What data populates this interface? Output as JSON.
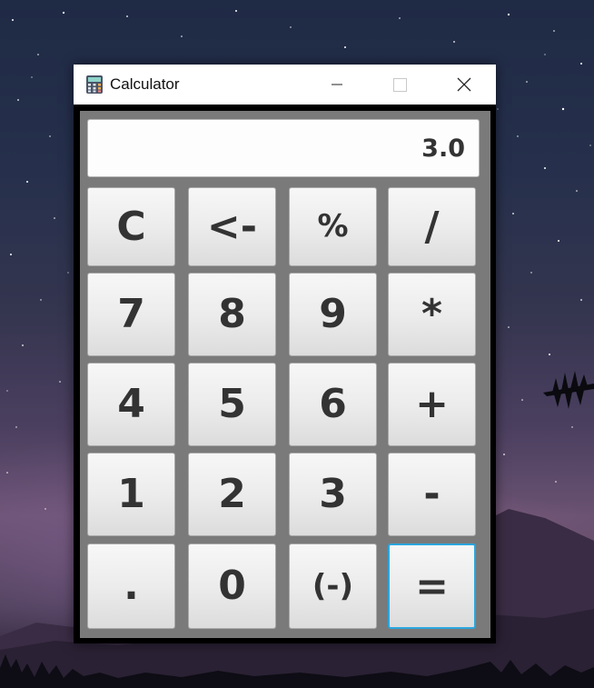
{
  "window": {
    "title": "Calculator",
    "icon": "calculator-app-icon",
    "controls": [
      "minimize-icon",
      "maximize-icon",
      "close-icon"
    ]
  },
  "display": {
    "value": "3.0"
  },
  "keypad": {
    "row1": [
      "C",
      "<-",
      "%",
      "/"
    ],
    "row2": [
      "7",
      "8",
      "9",
      "*"
    ],
    "row3": [
      "4",
      "5",
      "6",
      "+"
    ],
    "row4": [
      "1",
      "2",
      "3",
      "-"
    ],
    "row5": [
      ".",
      "0",
      "(-)",
      "="
    ]
  },
  "colors": {
    "client_background": "#7a7a7a",
    "focus_outline": "#2aa6de"
  }
}
